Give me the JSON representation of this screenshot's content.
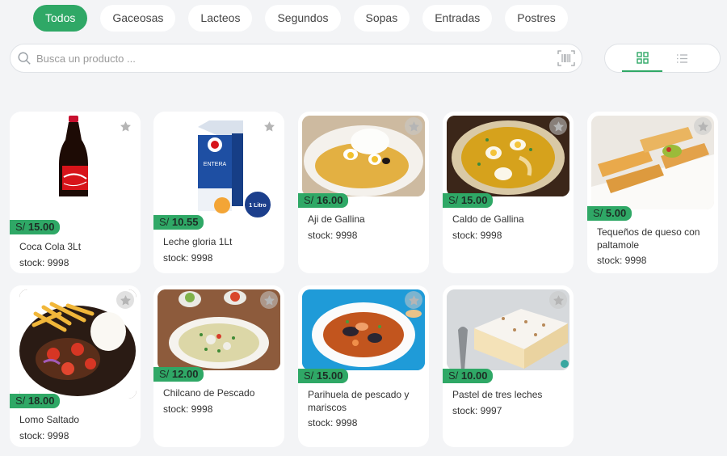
{
  "categories": [
    "Todos",
    "Gaceosas",
    "Lacteos",
    "Segundos",
    "Sopas",
    "Entradas",
    "Postres"
  ],
  "search": {
    "placeholder": "Busca un producto ..."
  },
  "view_toggle": {
    "active": "grid",
    "accent": "#2fa866"
  },
  "currency": "S/",
  "products": [
    {
      "name": "Coca Cola 3Lt",
      "price": "15.00",
      "stock": "stock: 9998"
    },
    {
      "name": "Leche gloria 1Lt",
      "price": "10.55",
      "stock": "stock: 9998",
      "badge": "1 Litro"
    },
    {
      "name": "Aji de Gallina",
      "price": "16.00",
      "stock": "stock: 9998"
    },
    {
      "name": "Caldo de Gallina",
      "price": "15.00",
      "stock": "stock: 9998"
    },
    {
      "name": "Tequeños de queso con paltamole",
      "price": "5.00",
      "stock": "stock: 9998"
    },
    {
      "name": "Lomo Saltado",
      "price": "18.00",
      "stock": "stock: 9998"
    },
    {
      "name": "Chilcano de Pescado",
      "price": "12.00",
      "stock": "stock: 9998"
    },
    {
      "name": "Parihuela de pescado y mariscos",
      "price": "15.00",
      "stock": "stock: 9998"
    },
    {
      "name": "Pastel de tres leches",
      "price": "10.00",
      "stock": "stock: 9997"
    }
  ]
}
